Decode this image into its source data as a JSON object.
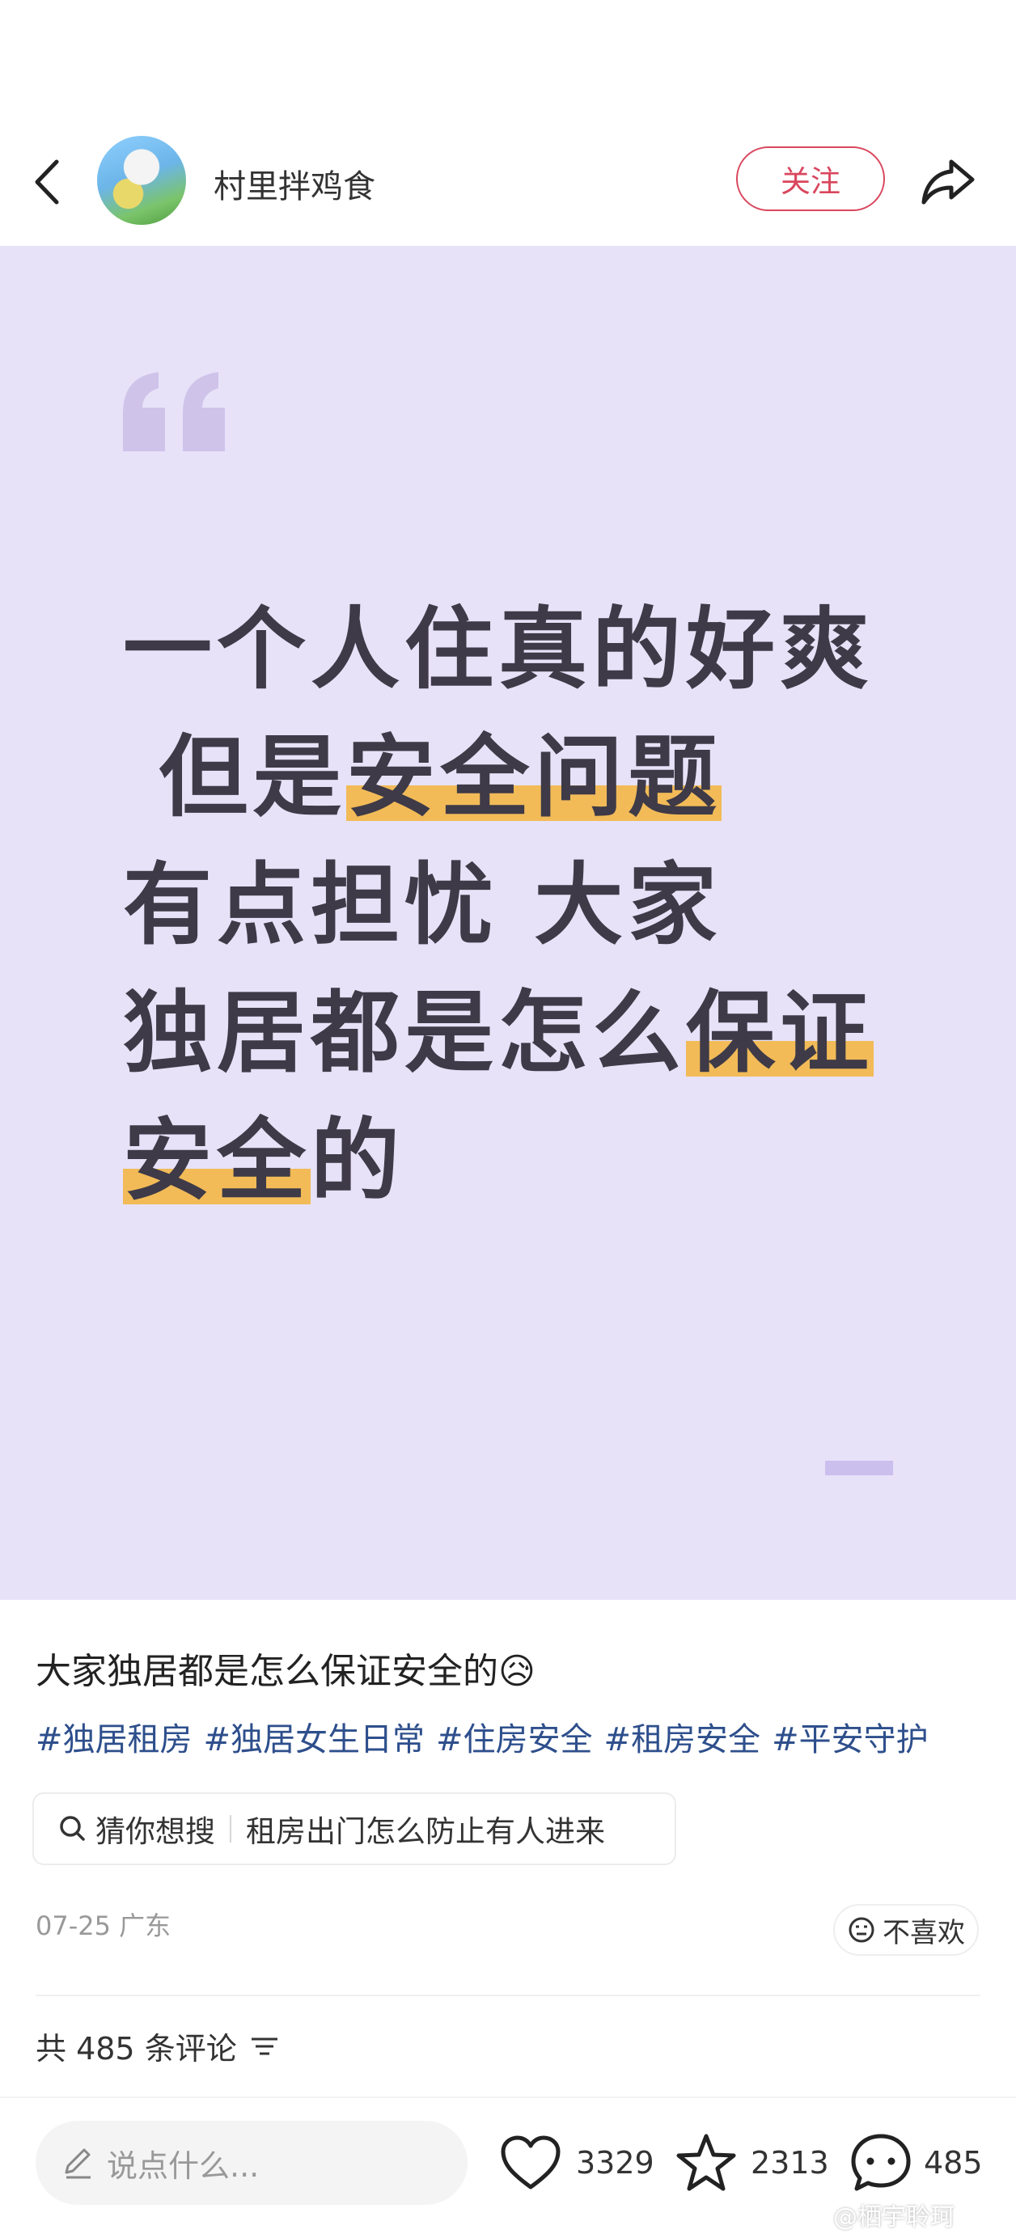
{
  "header": {
    "author_name": "村里拌鸡食",
    "follow_label": "关注",
    "icons": [
      "back-arrow-icon",
      "share-icon"
    ]
  },
  "hero": {
    "lines": [
      [
        {
          "t": "一个人住真的好爽",
          "hl": false
        }
      ],
      [
        {
          "t": " 但是",
          "hl": false
        },
        {
          "t": "安全问题",
          "hl": true
        }
      ],
      [
        {
          "t": "有点担忧 大家",
          "hl": false
        }
      ],
      [
        {
          "t": "独居都是怎么",
          "hl": false
        },
        {
          "t": "保证",
          "hl": true
        }
      ],
      [
        {
          "t": "安全",
          "hl": true
        },
        {
          "t": "的",
          "hl": false
        }
      ]
    ],
    "background_color": "#e7e2f8",
    "highlight_color": "#f2bb58"
  },
  "post": {
    "title": "大家独居都是怎么保证安全的😥",
    "tags": [
      "#独居租房",
      "#独居女生日常",
      "#住房安全",
      "#租房安全",
      "#平安守护"
    ],
    "suggest_prefix": "猜你想搜",
    "suggest_query": "租房出门怎么防止有人进来",
    "meta": "07-25 广东",
    "dislike_label": "不喜欢",
    "comment_count_label": "共 485 条评论"
  },
  "bottom": {
    "input_placeholder": "说点什么...",
    "likes": "3329",
    "favorites": "2313",
    "comments": "485"
  },
  "watermark": "@栖宇聆珂"
}
